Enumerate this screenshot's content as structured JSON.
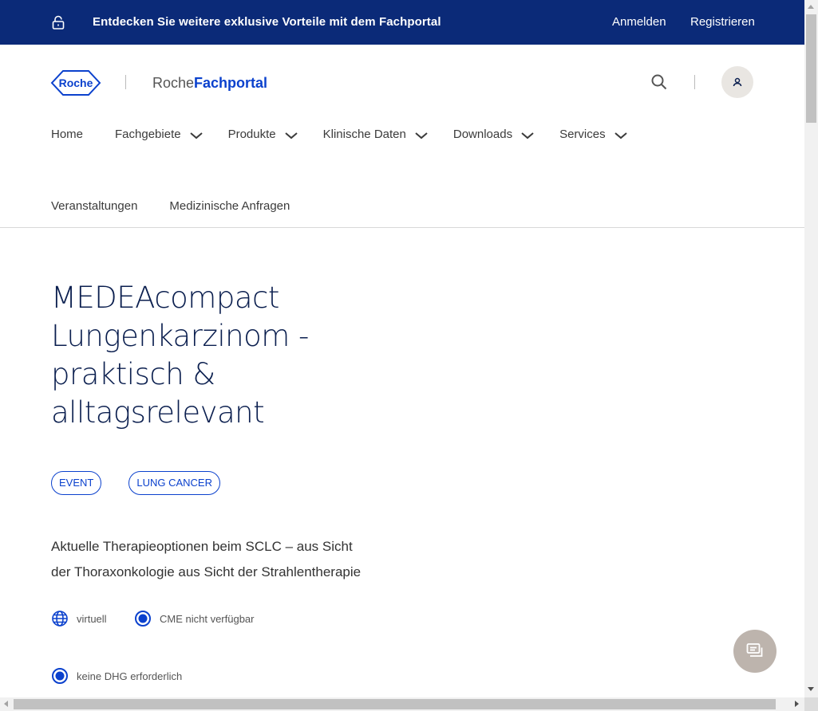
{
  "banner": {
    "text": "Entdecken Sie weitere exklusive Vorteile mit dem Fachportal",
    "login": "Anmelden",
    "register": "Registrieren",
    "icon": "lock-icon",
    "background": "#0b2a78"
  },
  "header": {
    "logo_text": "Roche",
    "brand_prefix": "Roche",
    "brand_suffix": "Fachportal",
    "brand_color": "#0b41cd"
  },
  "nav": {
    "row1": [
      {
        "label": "Home",
        "has_dropdown": false
      },
      {
        "label": "Fachgebiete",
        "has_dropdown": true
      },
      {
        "label": "Produkte",
        "has_dropdown": true
      },
      {
        "label": "Klinische Daten",
        "has_dropdown": true
      },
      {
        "label": "Downloads",
        "has_dropdown": true
      },
      {
        "label": "Services",
        "has_dropdown": true
      }
    ],
    "row2": [
      {
        "label": "Veranstaltungen"
      },
      {
        "label": "Medizinische Anfragen"
      }
    ]
  },
  "main": {
    "title": "MEDEAcompact Lungenkarzinom - praktisch & alltagsrelevant",
    "tags": [
      "EVENT",
      "LUNG CANCER"
    ],
    "description_line1": "Aktuelle Therapieoptionen beim SCLC – aus Sicht",
    "description_line2": "der Thoraxonkologie aus Sicht der Strahlentherapie",
    "meta": {
      "virtual": "virtuell",
      "cme": "CME nicht verfügbar",
      "dhg": "keine DHG erforderlich"
    }
  }
}
